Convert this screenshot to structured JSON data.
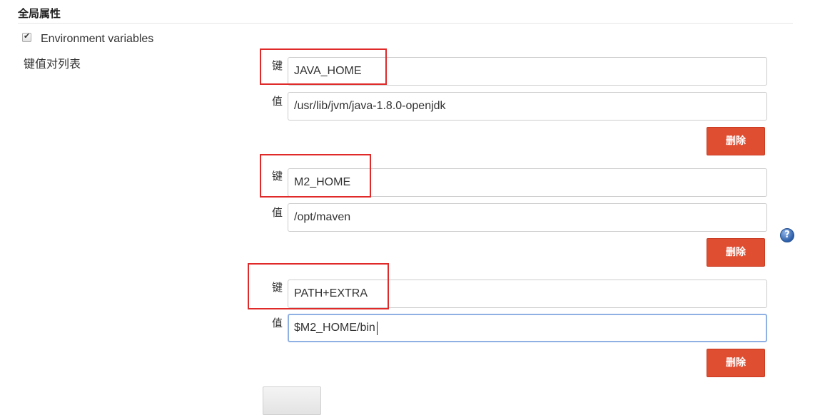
{
  "section": {
    "title": "全局属性"
  },
  "env": {
    "checked": true,
    "label": "Environment variables"
  },
  "list_label": "键值对列表",
  "key_label": "键",
  "value_label": "值",
  "entries": [
    {
      "key": "JAVA_HOME",
      "value": "/usr/lib/jvm/java-1.8.0-openjdk",
      "delete_label": "删除"
    },
    {
      "key": "M2_HOME",
      "value": "/opt/maven",
      "delete_label": "删除"
    },
    {
      "key": "PATH+EXTRA",
      "value": "$M2_HOME/bin",
      "delete_label": "删除"
    }
  ],
  "add_button": {
    "label": ""
  },
  "help_icon": "?",
  "colors": {
    "delete_button": "#e04e32",
    "annotation_box": "#e02a2a",
    "focus_border": "#8fb0e3",
    "help_icon": "#2d5faa"
  }
}
